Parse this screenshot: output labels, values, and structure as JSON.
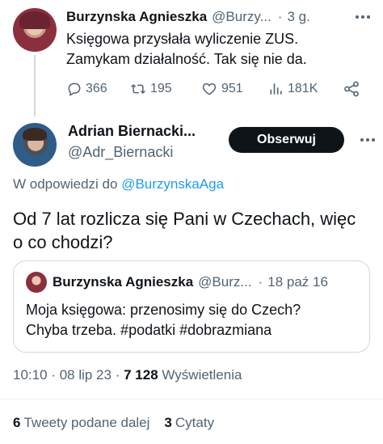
{
  "parent_tweet": {
    "author_name": "Burzynska Agnieszka",
    "author_handle": "@Burzy...",
    "separator": "·",
    "time": "3 g.",
    "text_line1": "Księgowa przysłała wyliczenie ZUS.",
    "text_line2": "Zamykam działalność. Tak się nie da.",
    "replies": "366",
    "retweets": "195",
    "likes": "951",
    "views": "181K"
  },
  "main_tweet": {
    "author_name": "Adrian Biernacki...",
    "author_handle": "@Adr_Biernacki",
    "follow_label": "Obserwuj",
    "replying_prefix": "W odpowiedzi do",
    "replying_handle": "@BurzynskaAga",
    "text": "Od 7 lat rozlicza się Pani w Czechach, więc o co chodzi?"
  },
  "quoted_tweet": {
    "author_name": "Burzynska Agnieszka",
    "author_handle": "@Burz...",
    "separator": "·",
    "date": "18 paź 16",
    "text_line1": "Moja księgowa: przenosimy się do Czech?",
    "text_line2": "Chyba trzeba. #podatki #dobrazmiana"
  },
  "meta": {
    "time": "10:10",
    "sep1": "·",
    "date": "08 lip 23",
    "sep2": "·",
    "views_count": "7 128",
    "views_label": "Wyświetlenia"
  },
  "stats": {
    "retweets_count": "6",
    "retweets_label": "Tweety podane dalej",
    "quotes_count": "3",
    "quotes_label": "Cytaty"
  },
  "colors": {
    "text": "#0f1419",
    "secondary": "#536471",
    "link": "#1d9bf0",
    "border": "#cfd9de"
  },
  "icons": [
    "more-icon",
    "reply-icon",
    "retweet-icon",
    "like-icon",
    "views-icon",
    "share-icon"
  ]
}
